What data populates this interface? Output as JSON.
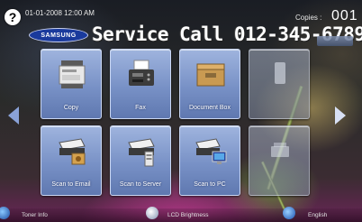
{
  "status_bar": {
    "help_symbol": "?",
    "datetime": "01-01-2008 12:00 AM",
    "copies_label": "Copies :",
    "copies_value": "001"
  },
  "banner": {
    "brand": "SAMSUNG",
    "service_call": "Service Call 012-345-6789"
  },
  "tiles": [
    {
      "label": "Copy",
      "icon": "copier-icon",
      "enabled": true
    },
    {
      "label": "Fax",
      "icon": "fax-machine-icon",
      "enabled": true
    },
    {
      "label": "Document Box",
      "icon": "document-box-icon",
      "enabled": true
    },
    {
      "label": "",
      "icon": "empty-slot-icon",
      "enabled": false
    },
    {
      "label": "Scan to Email",
      "icon": "scan-to-email-icon",
      "enabled": true
    },
    {
      "label": "Scan to Server",
      "icon": "scan-to-server-icon",
      "enabled": true
    },
    {
      "label": "Scan to PC",
      "icon": "scan-to-pc-icon",
      "enabled": true
    },
    {
      "label": "",
      "icon": "empty-slot-icon",
      "enabled": false
    }
  ],
  "footer": {
    "toner_label": "Toner Info",
    "brightness_label": "LCD Brightness",
    "language_label": "English"
  },
  "colors": {
    "tile_top": "#9fb4de",
    "tile_bottom": "#5f78b0",
    "logo_blue": "#1a3a9c"
  }
}
